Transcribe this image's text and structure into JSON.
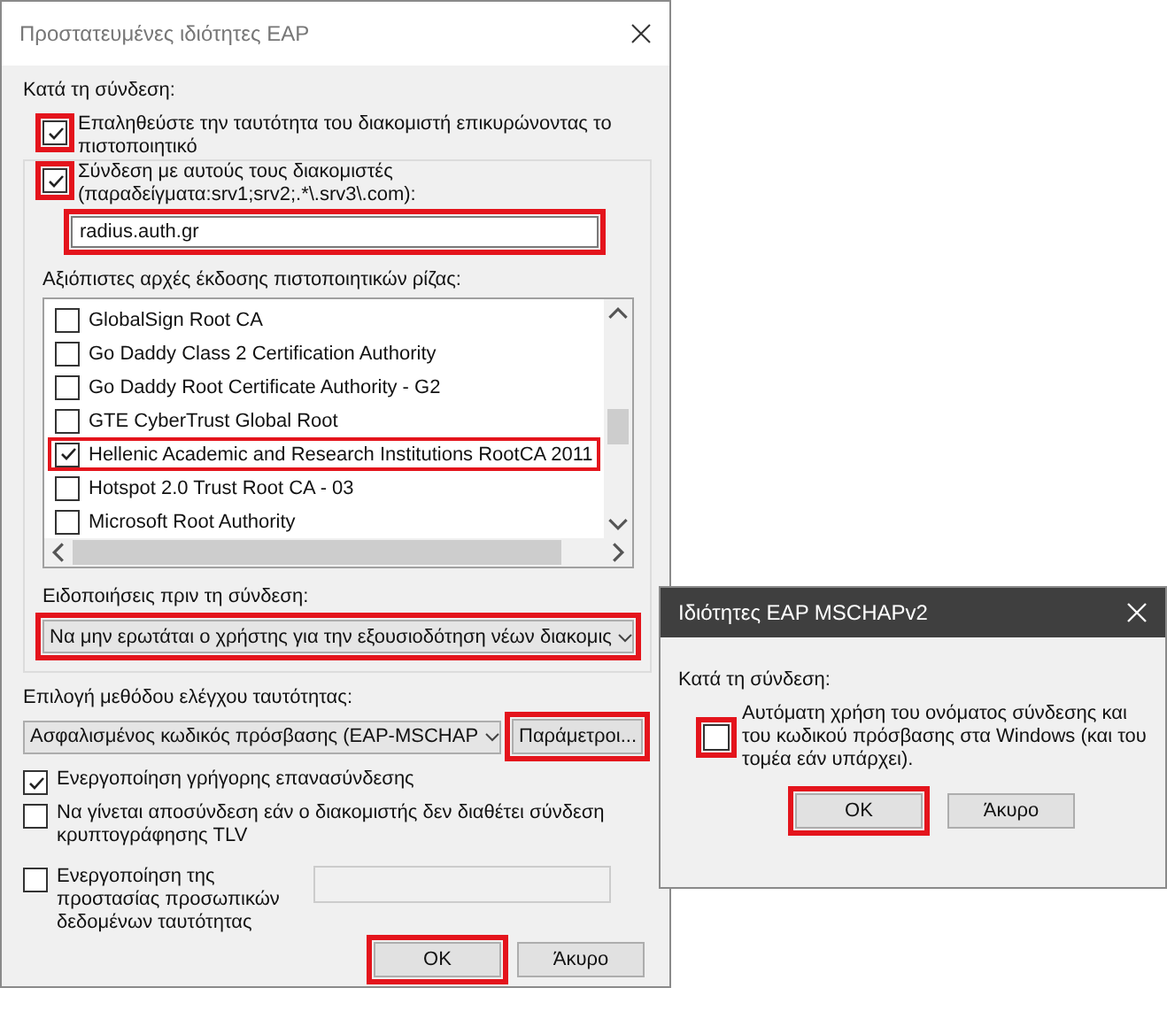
{
  "main_dialog": {
    "title": "Προστατευμένες ιδιότητες EAP",
    "section_label": "Κατά τη σύνδεση:",
    "validate_server": {
      "label": "Επαληθεύστε την ταυτότητα του διακομιστή επικυρώνοντας το πιστοποιητικό",
      "checked": true,
      "highlighted": true
    },
    "connect_to_servers": {
      "label": "Σύνδεση με αυτούς τους διακομιστές (παραδείγματα:srv1;srv2;.*\\.srv3\\.com):",
      "checked": true,
      "highlighted": true
    },
    "servers_field": {
      "value": "radius.auth.gr",
      "highlighted": true
    },
    "trusted_ca_label": "Αξιόπιστες αρχές έκδοσης πιστοποιητικών ρίζας:",
    "trusted_cas": [
      {
        "label": "GlobalSign Root CA",
        "checked": false,
        "highlighted": false
      },
      {
        "label": "Go Daddy Class 2 Certification Authority",
        "checked": false,
        "highlighted": false
      },
      {
        "label": "Go Daddy Root Certificate Authority - G2",
        "checked": false,
        "highlighted": false
      },
      {
        "label": "GTE CyberTrust Global Root",
        "checked": false,
        "highlighted": false
      },
      {
        "label": "Hellenic Academic and Research Institutions RootCA 2011",
        "checked": true,
        "highlighted": true
      },
      {
        "label": "Hotspot 2.0 Trust Root CA - 03",
        "checked": false,
        "highlighted": false
      },
      {
        "label": "Microsoft Root Authority",
        "checked": false,
        "highlighted": false
      }
    ],
    "notifications_label": "Ειδοποιήσεις πριν τη σύνδεση:",
    "notifications_dropdown": {
      "value": "Να μην ερωτάται ο χρήστης για την εξουσιοδότηση νέων διακομις",
      "highlighted": true
    },
    "method_label": "Επιλογή μεθόδου ελέγχου ταυτότητας:",
    "method_dropdown": {
      "value": "Ασφαλισμένος κωδικός πρόσβασης (EAP-MSCHAP"
    },
    "params_button": {
      "label": "Παράμετροι...",
      "highlighted": true
    },
    "options": [
      {
        "kind": "checkbox",
        "label": "Ενεργοποίηση γρήγορης επανασύνδεσης",
        "checked": true
      },
      {
        "kind": "checkbox",
        "label": "Να γίνεται αποσύνδεση εάν ο διακομιστής δεν διαθέτει σύνδεση κρυπτογράφησης TLV",
        "checked": false
      },
      {
        "kind": "checkbox_field",
        "label": "Ενεργοποίηση της προστασίας προσωπικών δεδομένων ταυτότητας",
        "checked": false
      }
    ],
    "buttons": [
      {
        "label": "OK",
        "highlighted": true
      },
      {
        "label": "Άκυρο",
        "highlighted": false
      }
    ]
  },
  "mschap_dialog": {
    "title": "Ιδιότητες EAP MSCHAPv2",
    "section_label": "Κατά τη σύνδεση:",
    "auto_logon": {
      "label": "Αυτόματη χρήση του ονόματος σύνδεσης και του κωδικού πρόσβασης στα Windows (και του τομέα εάν υπάρχει).",
      "checked": false,
      "highlighted": true
    },
    "buttons": [
      {
        "label": "OK",
        "highlighted": true
      },
      {
        "label": "Άκυρο",
        "highlighted": false
      }
    ]
  }
}
